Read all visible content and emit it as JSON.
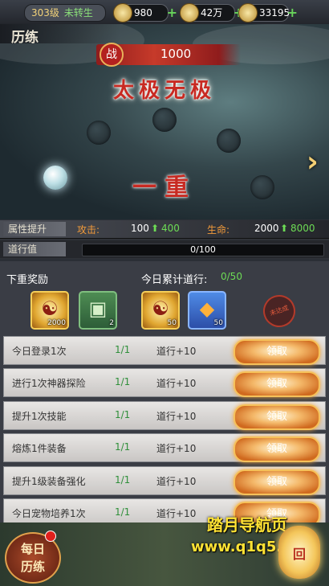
{
  "topbar": {
    "level": "303级",
    "rebirth": "未转生",
    "resources": [
      {
        "icon": "coin-icon",
        "value": "980"
      },
      {
        "icon": "ingot-icon",
        "value": "42万"
      },
      {
        "icon": "copper-coin-icon",
        "value": "33195"
      }
    ],
    "plus": "+"
  },
  "scene": {
    "header": "历练",
    "power_tag": "战",
    "power_value": "1000",
    "realm_title": "太极无极",
    "stage_name": "一重",
    "next_arrow": "›"
  },
  "attributes": {
    "label": "属性提升",
    "attack_label": "攻击:",
    "attack_value": "100",
    "attack_up": "400",
    "hp_label": "生命:",
    "hp_value": "2000",
    "hp_up": "8000",
    "dao_label": "道行值",
    "dao_progress_text": "0/100",
    "dao_progress_fraction": 0
  },
  "rewards": {
    "next_title": "下重奖励",
    "daily_title": "今日累计道行:",
    "daily_progress": "0/50",
    "next_items": [
      {
        "icon": "gold-talisman-icon",
        "count": "2000"
      },
      {
        "icon": "jade-chest-icon",
        "count": "2"
      }
    ],
    "daily_items": [
      {
        "icon": "gold-talisman-icon",
        "count": "50"
      },
      {
        "icon": "amber-gem-icon",
        "count": "50"
      }
    ],
    "stamp": "未达成"
  },
  "tasks": [
    {
      "name": "今日登录1次",
      "progress": "1/1",
      "reward": "道行+10",
      "button": "领取"
    },
    {
      "name": "进行1次神器探险",
      "progress": "1/1",
      "reward": "道行+10",
      "button": "领取"
    },
    {
      "name": "提升1次技能",
      "progress": "1/1",
      "reward": "道行+10",
      "button": "领取"
    },
    {
      "name": "熔炼1件装备",
      "progress": "1/1",
      "reward": "道行+10",
      "button": "领取"
    },
    {
      "name": "提升1级装备强化",
      "progress": "1/1",
      "reward": "道行+10",
      "button": "领取"
    },
    {
      "name": "今日宠物培养1次",
      "progress": "1/1",
      "reward": "道行+10",
      "button": "领取"
    }
  ],
  "bottom": {
    "daily_button_line1": "每日",
    "daily_button_line2": "历练",
    "watermark_line1": "踏月导航页",
    "watermark_line2": "www.q1q5.com",
    "lantern": "回"
  }
}
